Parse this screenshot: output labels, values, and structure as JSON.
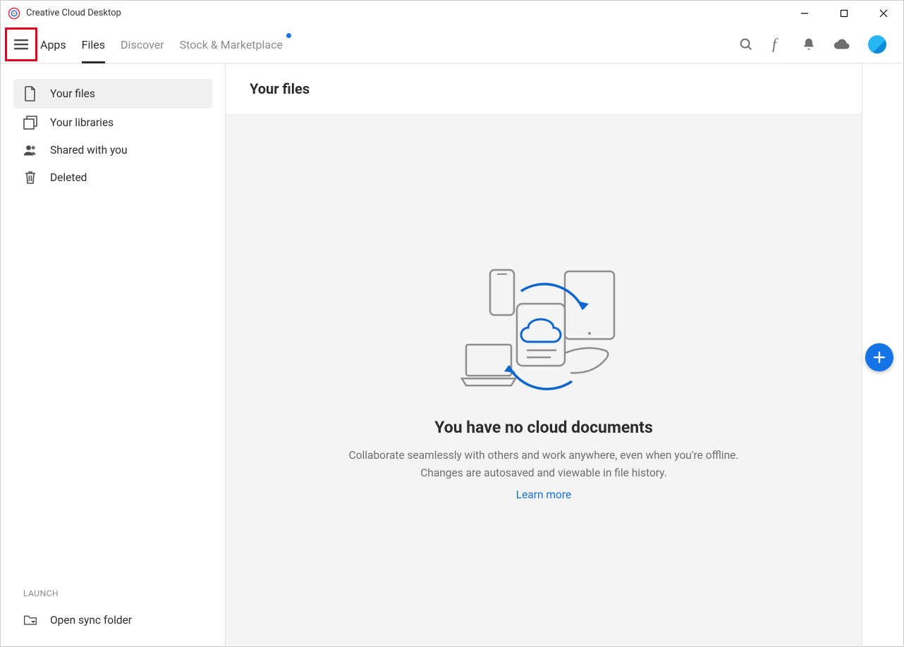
{
  "window": {
    "title": "Creative Cloud Desktop"
  },
  "nav": {
    "tabs": [
      {
        "label": "Apps"
      },
      {
        "label": "Files"
      },
      {
        "label": "Discover"
      },
      {
        "label": "Stock & Marketplace"
      }
    ]
  },
  "sidebar": {
    "items": [
      {
        "label": "Your files"
      },
      {
        "label": "Your libraries"
      },
      {
        "label": "Shared with you"
      },
      {
        "label": "Deleted"
      }
    ],
    "launch_label": "LAUNCH",
    "open_sync_label": "Open sync folder"
  },
  "main": {
    "header": "Your files",
    "empty": {
      "title": "You have no cloud documents",
      "description": "Collaborate seamlessly with others and work anywhere, even when you're offline. Changes are autosaved and viewable in file history.",
      "learn_more": "Learn more"
    }
  }
}
